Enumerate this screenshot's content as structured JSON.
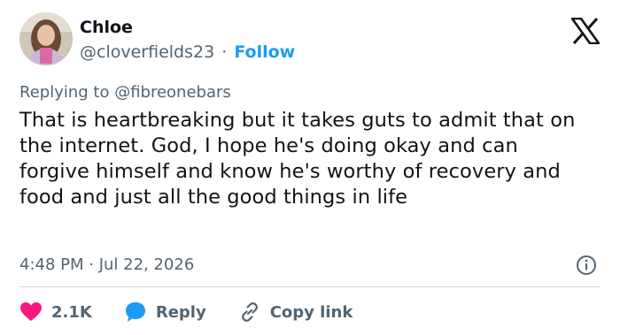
{
  "user": {
    "name": "Chloe",
    "handle": "@cloverfields23",
    "separator": "·",
    "follow_label": "Follow"
  },
  "replying_to": "Replying to @fibreonebars",
  "tweet_text": "That is heartbreaking but it takes guts to admit that on the internet. God, I hope he's doing okay and can forgive himself and know he's worthy of recovery and food and just all the good things in life",
  "timestamp": "4:48 PM · Jul 22, 2026",
  "actions": {
    "like_count": "2.1K",
    "reply_label": "Reply",
    "copy_link_label": "Copy link"
  },
  "icons": {
    "logo": "x-logo",
    "info": "info-icon",
    "like": "heart-icon",
    "reply": "speech-bubble-icon",
    "copy": "link-icon"
  },
  "colors": {
    "accent": "#1d9bf0",
    "like": "#f91880",
    "text": "#0f1419",
    "secondary": "#536471"
  }
}
